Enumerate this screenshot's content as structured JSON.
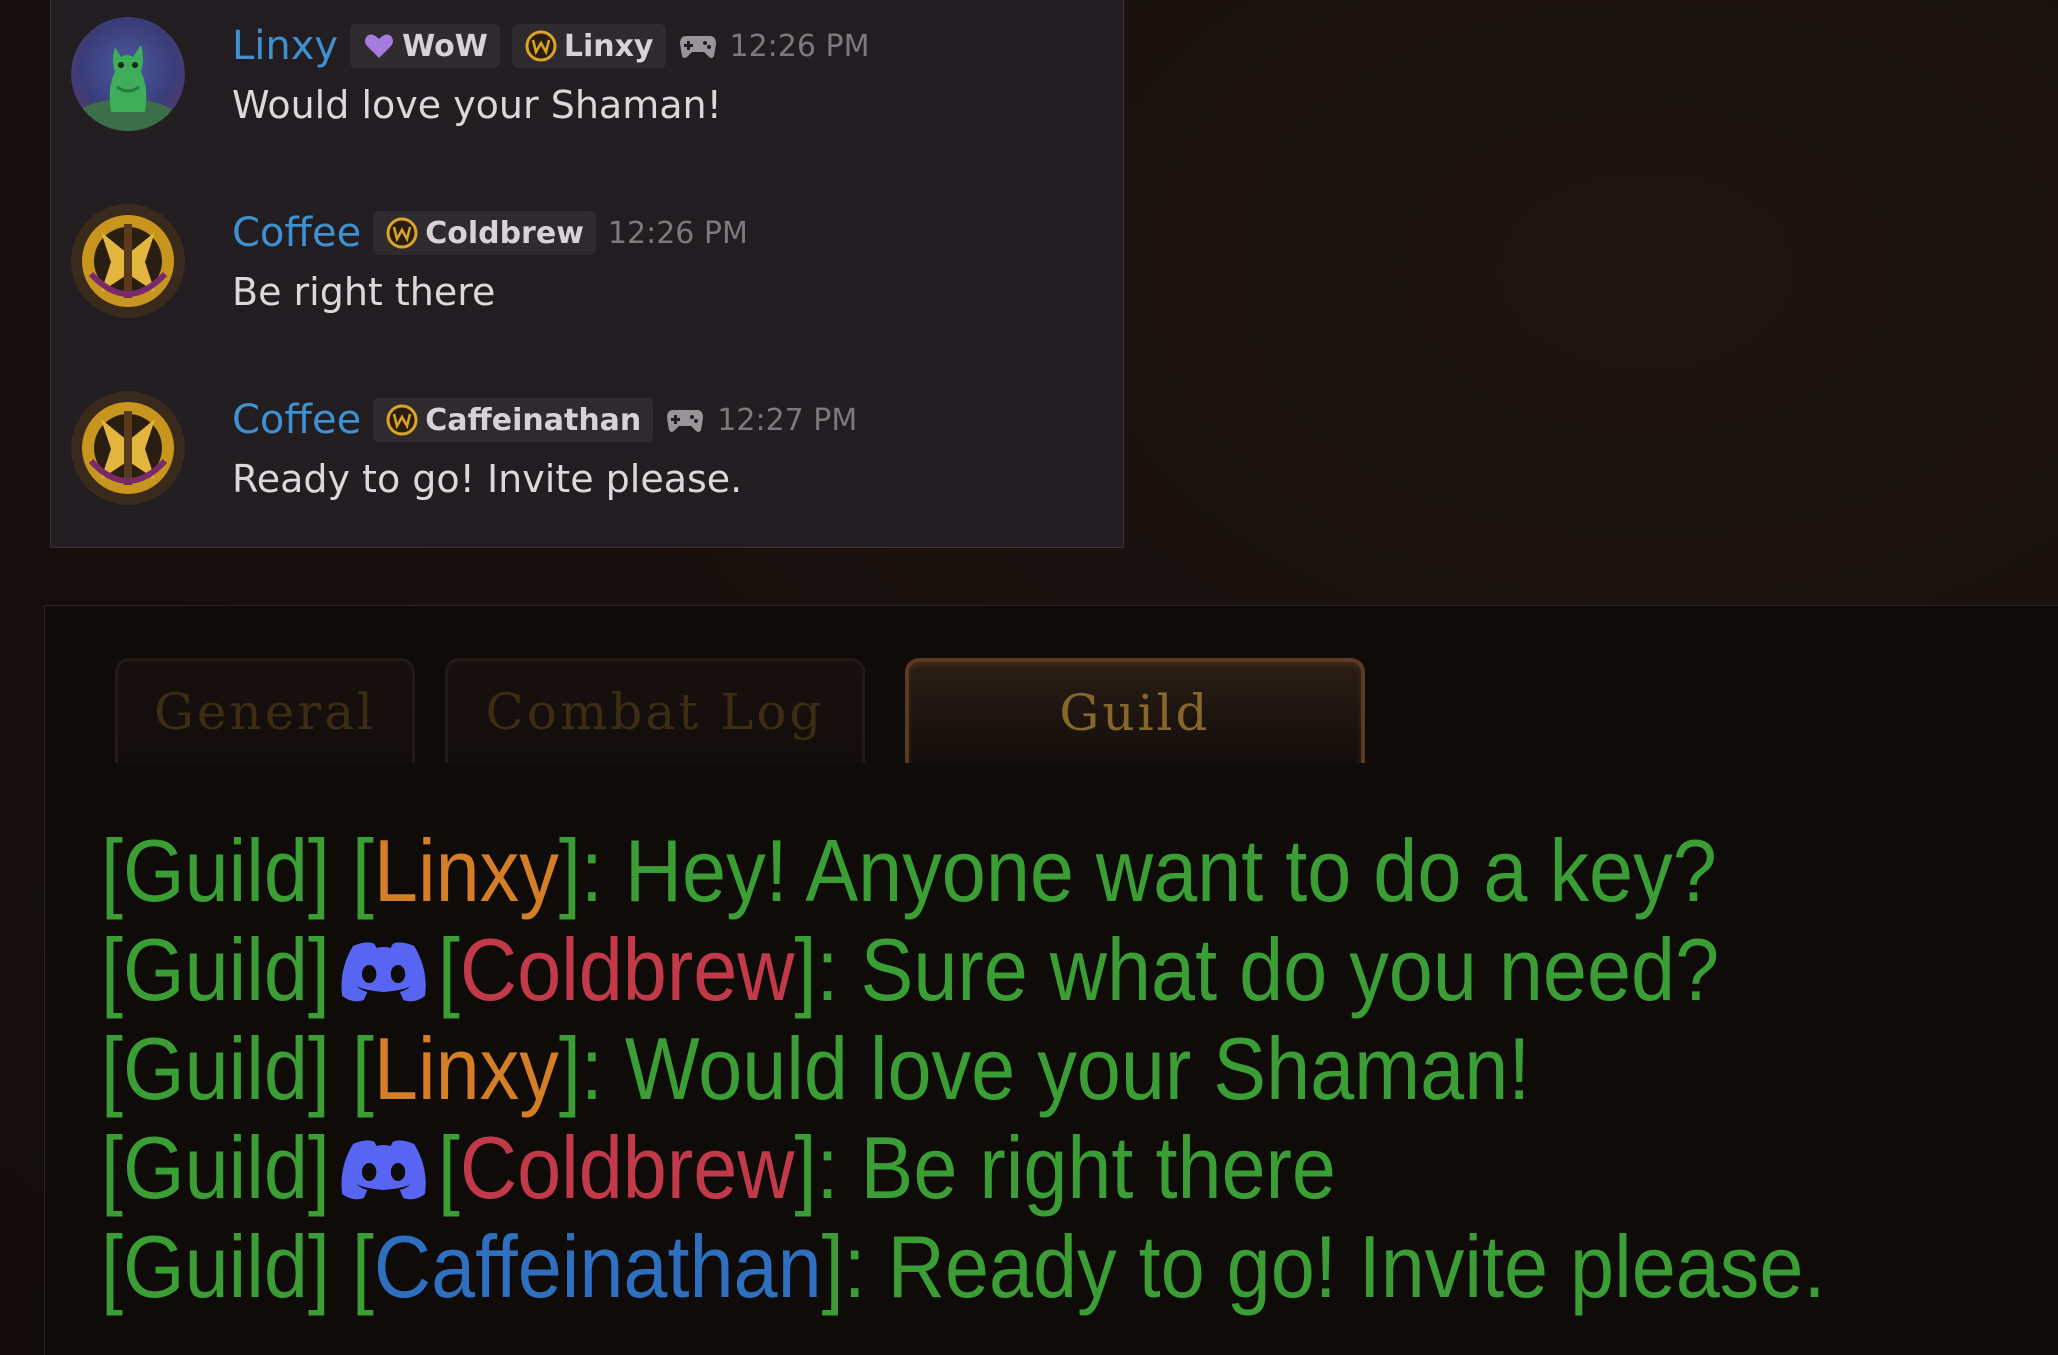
{
  "discord": {
    "messages": [
      {
        "username": "Linxy",
        "avatar": "green-creature-avatar",
        "tags": [
          {
            "icon": "purple-heart-icon",
            "label": "WoW"
          },
          {
            "icon": "wow-logo-icon",
            "label": "Linxy"
          }
        ],
        "show_game_icon": true,
        "timestamp": "12:26 PM",
        "text": "Would love your Shaman!"
      },
      {
        "username": "Coffee",
        "avatar": "horde-emblem-avatar",
        "tags": [
          {
            "icon": "wow-logo-icon",
            "label": "Coldbrew"
          }
        ],
        "show_game_icon": false,
        "timestamp": "12:26 PM",
        "text": "Be right there"
      },
      {
        "username": "Coffee",
        "avatar": "horde-emblem-avatar",
        "tags": [
          {
            "icon": "wow-logo-icon",
            "label": "Caffeinathan"
          }
        ],
        "show_game_icon": true,
        "timestamp": "12:27 PM",
        "text": "Ready to go! Invite please."
      }
    ],
    "colors": {
      "username": "#3f90cf",
      "text": "#dbd7da",
      "timestamp": "#7e787c"
    }
  },
  "wow_chat": {
    "tabs": [
      {
        "label": "General",
        "active": false
      },
      {
        "label": "Combat Log",
        "active": false
      },
      {
        "label": "Guild",
        "active": true
      }
    ],
    "lines": [
      {
        "channel": "[Guild]",
        "discord_icon": false,
        "open": "[",
        "sender": "Linxy",
        "close": "]",
        "message": ": Hey! Anyone want to do a key?",
        "sender_color": "orange"
      },
      {
        "channel": "[Guild]",
        "discord_icon": true,
        "open": "[",
        "sender": "Coldbrew",
        "close": "]",
        "message": ": Sure what do you need?",
        "sender_color": "red"
      },
      {
        "channel": "[Guild]",
        "discord_icon": false,
        "open": "[",
        "sender": "Linxy",
        "close": "]",
        "message": ": Would love your Shaman!",
        "sender_color": "orange"
      },
      {
        "channel": "[Guild]",
        "discord_icon": true,
        "open": "[",
        "sender": "Coldbrew",
        "close": "]",
        "message": ": Be right there",
        "sender_color": "red"
      },
      {
        "channel": "[Guild]",
        "discord_icon": false,
        "open": "[",
        "sender": "Caffeinathan",
        "close": "]",
        "message": ": Ready to go! Invite please.",
        "sender_color": "blue"
      }
    ],
    "colors": {
      "guild_text": "#3a9e35",
      "orange": "#d47f25",
      "red": "#c23a4a",
      "blue": "#2e6fbf",
      "discord_icon": "#5865f2"
    }
  }
}
